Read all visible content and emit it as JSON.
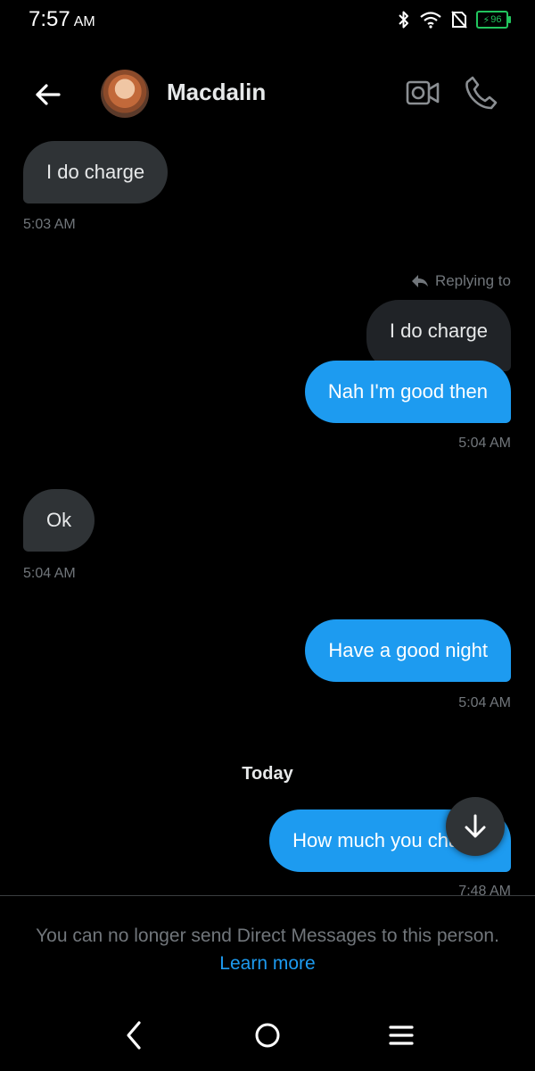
{
  "status_bar": {
    "time": "7:57",
    "ampm": "AM",
    "battery_level": "96",
    "icons": [
      "bluetooth-icon",
      "wifi-icon",
      "no-sim-icon",
      "battery-icon"
    ]
  },
  "header": {
    "contact_name": "Macdalin",
    "icons": [
      "back-arrow-icon",
      "video-call-icon",
      "phone-icon"
    ]
  },
  "messages": [
    {
      "direction": "in",
      "text": "I do charge",
      "time": "5:03 AM"
    },
    {
      "direction": "out",
      "replying_to_label": "Replying to",
      "quoted_text": "I do charge",
      "text": "Nah I'm good then",
      "time": "5:04 AM"
    },
    {
      "direction": "in",
      "text": "Ok",
      "time": "5:04 AM"
    },
    {
      "direction": "out",
      "text": "Have a good night",
      "time": "5:04 AM"
    },
    {
      "direction": "out",
      "text": "How much you charge",
      "time": "7:48 AM"
    }
  ],
  "date_separator": "Today",
  "footer": {
    "notice": "You can no longer send Direct Messages to this person.",
    "learn_more": "Learn more"
  },
  "colors": {
    "background": "#000000",
    "incoming_bubble": "#2f3336",
    "outgoing_bubble": "#1d9bf0",
    "muted_text": "#71767b",
    "link": "#1d9bf0"
  }
}
